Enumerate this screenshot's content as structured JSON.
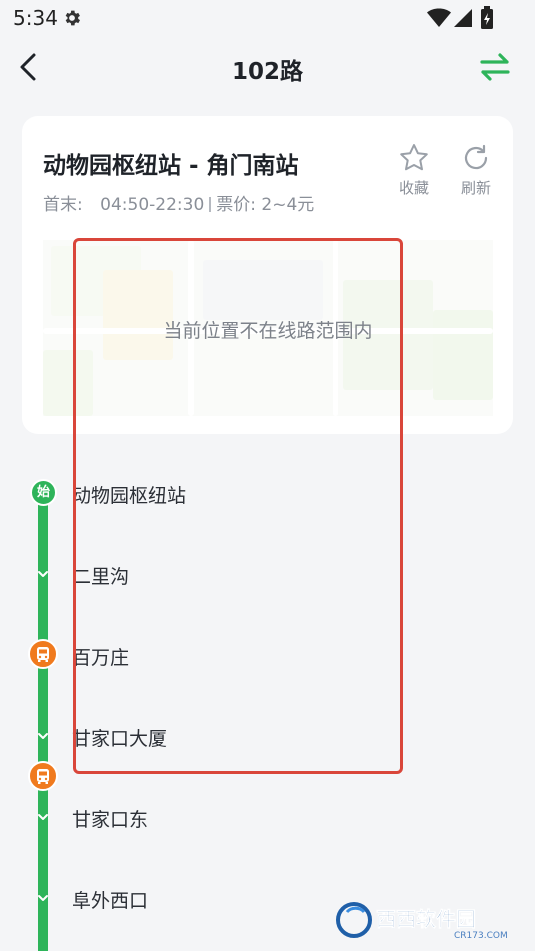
{
  "status_bar": {
    "time": "5:34"
  },
  "header": {
    "title": "102路"
  },
  "route_card": {
    "name": "动物园枢纽站 - 角门南站",
    "hours_label": "首末:",
    "hours": "04:50-22:30",
    "fare": "票价: 2~4元",
    "favorite_label": "收藏",
    "refresh_label": "刷新",
    "map_message": "当前位置不在线路范围内"
  },
  "stops": [
    {
      "name": "动物园枢纽站",
      "marker": "start",
      "marker_text": "始"
    },
    {
      "name": "二里沟",
      "marker": "chevron"
    },
    {
      "name": "百万庄",
      "marker": "bus"
    },
    {
      "name": "甘家口大厦",
      "marker": "chevron"
    },
    {
      "name": "甘家口东",
      "marker": "chevron"
    },
    {
      "name": "阜外西口",
      "marker": "chevron"
    }
  ],
  "buses_between": [
    {
      "after_stop": "甘家口大厦",
      "icon": "bus-icon"
    }
  ],
  "watermark": {
    "text": "西西软件园",
    "subtext": "CR173.COM"
  },
  "colors": {
    "accent": "#2eb45a",
    "bus": "#f07a1e",
    "highlight": "#d9463a"
  }
}
